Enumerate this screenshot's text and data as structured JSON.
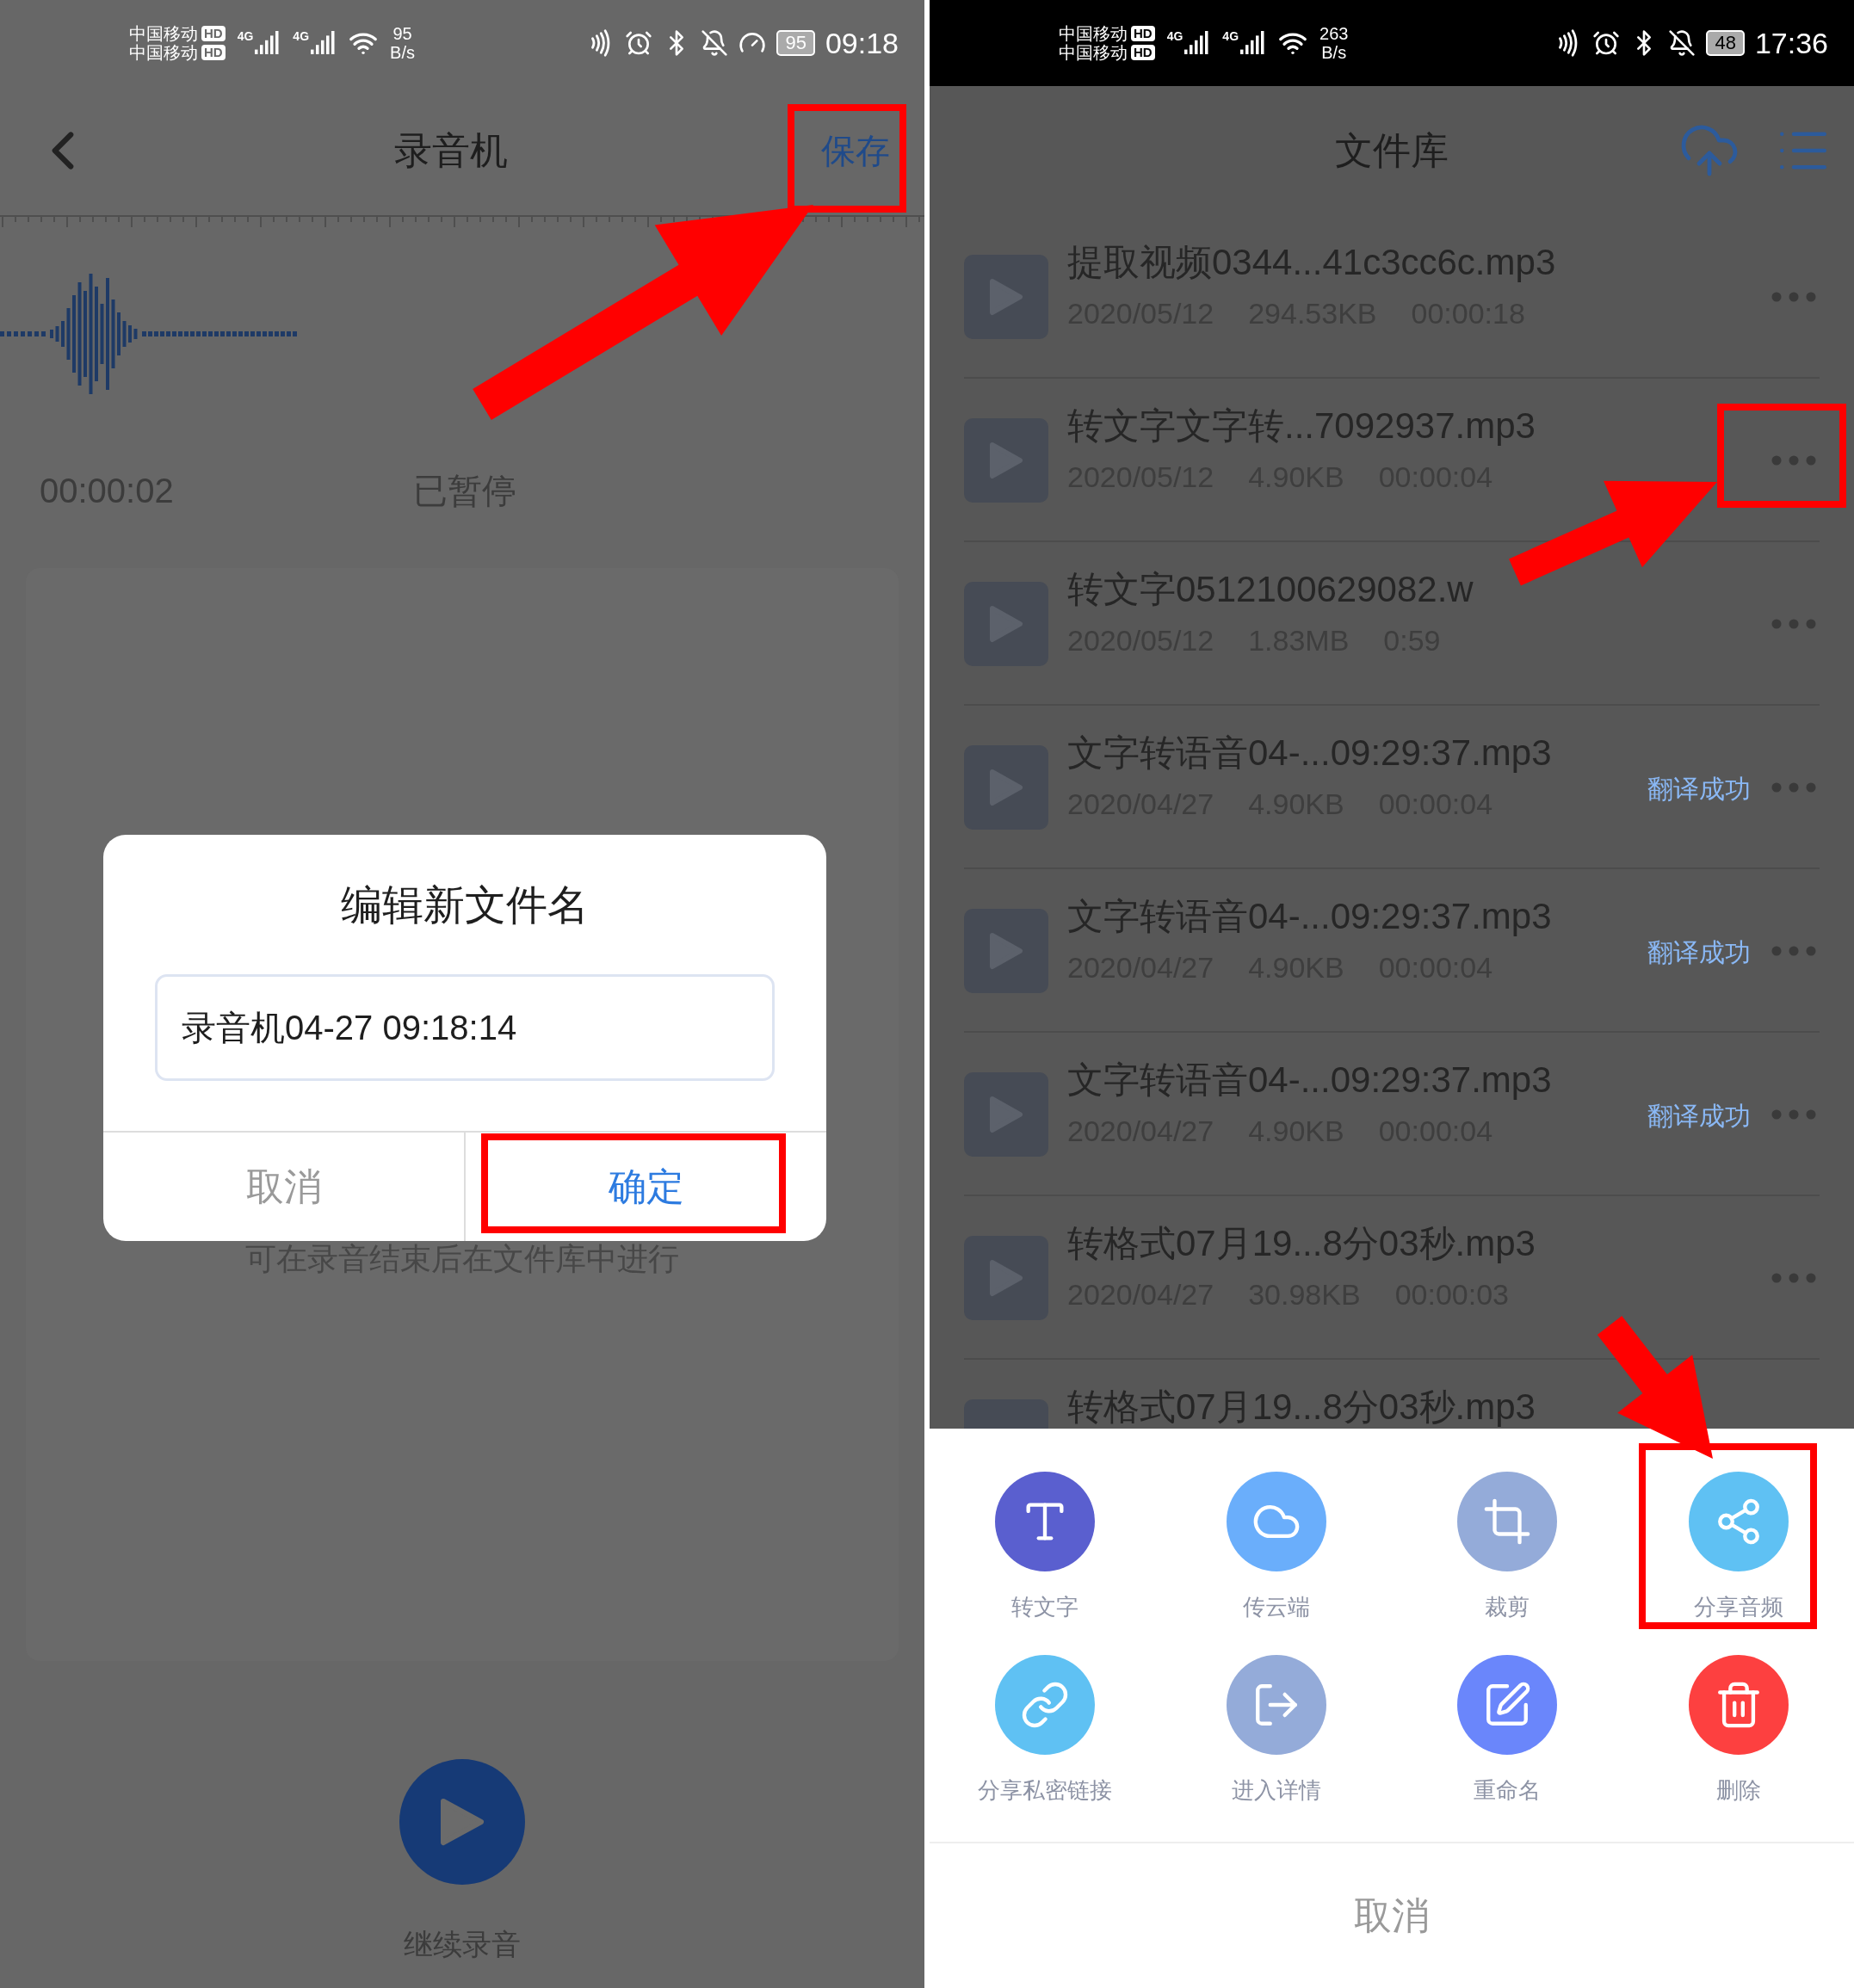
{
  "left": {
    "status_bar": {
      "carriers": [
        {
          "name": "中国移动",
          "badge": "HD"
        },
        {
          "name": "中国移动",
          "badge": "HD"
        }
      ],
      "networks": [
        "4G",
        "4G"
      ],
      "speed": "95",
      "speed_unit": "B/s",
      "battery": "95",
      "time": "09:18"
    },
    "header": {
      "title": "录音机",
      "action": "保存"
    },
    "recording": {
      "elapsed": "00:00:02",
      "status": "已暂停"
    },
    "hint": "可在录音结束后在文件库中进行",
    "dialog": {
      "title": "编辑新文件名",
      "value": "录音机04-27 09:18:14",
      "buttons": [
        {
          "label": "取消",
          "primary": false
        },
        {
          "label": "确定",
          "primary": true
        }
      ]
    },
    "resume": {
      "label": "继续录音"
    }
  },
  "right": {
    "status_bar": {
      "carriers": [
        {
          "name": "中国移动",
          "badge": "HD"
        },
        {
          "name": "中国移动",
          "badge": "HD"
        }
      ],
      "networks": [
        "4G",
        "4G"
      ],
      "speed": "263",
      "speed_unit": "B/s",
      "battery": "48",
      "time": "17:36"
    },
    "header": {
      "title": "文件库"
    },
    "files": [
      {
        "title": "提取视频0344...41c3cc6c.mp3",
        "date": "2020/05/12",
        "size": "294.53KB",
        "duration": "00:00:18"
      },
      {
        "title": "转文字文字转...7092937.mp3",
        "date": "2020/05/12",
        "size": "4.90KB",
        "duration": "00:00:04"
      },
      {
        "title": "转文字0512100629082.w",
        "date": "2020/05/12",
        "size": "1.83MB",
        "duration": "0:59"
      },
      {
        "title": "文字转语音04-...09:29:37.mp3",
        "date": "2020/04/27",
        "size": "4.90KB",
        "duration": "00:00:04",
        "status": "翻译成功"
      },
      {
        "title": "文字转语音04-...09:29:37.mp3",
        "date": "2020/04/27",
        "size": "4.90KB",
        "duration": "00:00:04",
        "status": "翻译成功"
      },
      {
        "title": "文字转语音04-...09:29:37.mp3",
        "date": "2020/04/27",
        "size": "4.90KB",
        "duration": "00:00:04",
        "status": "翻译成功"
      },
      {
        "title": "转格式07月19...8分03秒.mp3",
        "date": "2020/04/27",
        "size": "30.98KB",
        "duration": "00:00:03"
      },
      {
        "title": "转格式07月19...8分03秒.mp3"
      }
    ],
    "sheet": {
      "actions": [
        {
          "label": "转文字",
          "color": "#5a5fcf"
        },
        {
          "label": "传云端",
          "color": "#6aaefb"
        },
        {
          "label": "裁剪",
          "color": "#94abd9"
        },
        {
          "label": "分享音频",
          "color": "#5fc1f3"
        },
        {
          "label": "分享私密链接",
          "color": "#5fc1f3"
        },
        {
          "label": "进入详情",
          "color": "#94abd9"
        },
        {
          "label": "重命名",
          "color": "#6a86fb"
        },
        {
          "label": "删除",
          "color": "#fd4040"
        }
      ],
      "cancel": "取消"
    }
  }
}
